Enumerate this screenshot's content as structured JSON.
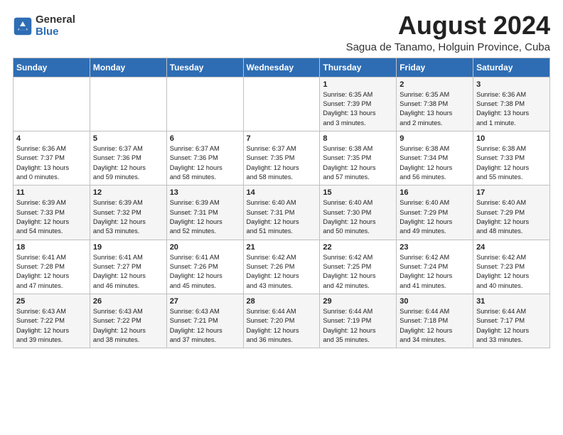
{
  "logo": {
    "general": "General",
    "blue": "Blue"
  },
  "title": "August 2024",
  "subtitle": "Sagua de Tanamo, Holguin Province, Cuba",
  "headers": [
    "Sunday",
    "Monday",
    "Tuesday",
    "Wednesday",
    "Thursday",
    "Friday",
    "Saturday"
  ],
  "weeks": [
    [
      {
        "day": "",
        "info": ""
      },
      {
        "day": "",
        "info": ""
      },
      {
        "day": "",
        "info": ""
      },
      {
        "day": "",
        "info": ""
      },
      {
        "day": "1",
        "info": "Sunrise: 6:35 AM\nSunset: 7:39 PM\nDaylight: 13 hours\nand 3 minutes."
      },
      {
        "day": "2",
        "info": "Sunrise: 6:35 AM\nSunset: 7:38 PM\nDaylight: 13 hours\nand 2 minutes."
      },
      {
        "day": "3",
        "info": "Sunrise: 6:36 AM\nSunset: 7:38 PM\nDaylight: 13 hours\nand 1 minute."
      }
    ],
    [
      {
        "day": "4",
        "info": "Sunrise: 6:36 AM\nSunset: 7:37 PM\nDaylight: 13 hours\nand 0 minutes."
      },
      {
        "day": "5",
        "info": "Sunrise: 6:37 AM\nSunset: 7:36 PM\nDaylight: 12 hours\nand 59 minutes."
      },
      {
        "day": "6",
        "info": "Sunrise: 6:37 AM\nSunset: 7:36 PM\nDaylight: 12 hours\nand 58 minutes."
      },
      {
        "day": "7",
        "info": "Sunrise: 6:37 AM\nSunset: 7:35 PM\nDaylight: 12 hours\nand 58 minutes."
      },
      {
        "day": "8",
        "info": "Sunrise: 6:38 AM\nSunset: 7:35 PM\nDaylight: 12 hours\nand 57 minutes."
      },
      {
        "day": "9",
        "info": "Sunrise: 6:38 AM\nSunset: 7:34 PM\nDaylight: 12 hours\nand 56 minutes."
      },
      {
        "day": "10",
        "info": "Sunrise: 6:38 AM\nSunset: 7:33 PM\nDaylight: 12 hours\nand 55 minutes."
      }
    ],
    [
      {
        "day": "11",
        "info": "Sunrise: 6:39 AM\nSunset: 7:33 PM\nDaylight: 12 hours\nand 54 minutes."
      },
      {
        "day": "12",
        "info": "Sunrise: 6:39 AM\nSunset: 7:32 PM\nDaylight: 12 hours\nand 53 minutes."
      },
      {
        "day": "13",
        "info": "Sunrise: 6:39 AM\nSunset: 7:31 PM\nDaylight: 12 hours\nand 52 minutes."
      },
      {
        "day": "14",
        "info": "Sunrise: 6:40 AM\nSunset: 7:31 PM\nDaylight: 12 hours\nand 51 minutes."
      },
      {
        "day": "15",
        "info": "Sunrise: 6:40 AM\nSunset: 7:30 PM\nDaylight: 12 hours\nand 50 minutes."
      },
      {
        "day": "16",
        "info": "Sunrise: 6:40 AM\nSunset: 7:29 PM\nDaylight: 12 hours\nand 49 minutes."
      },
      {
        "day": "17",
        "info": "Sunrise: 6:40 AM\nSunset: 7:29 PM\nDaylight: 12 hours\nand 48 minutes."
      }
    ],
    [
      {
        "day": "18",
        "info": "Sunrise: 6:41 AM\nSunset: 7:28 PM\nDaylight: 12 hours\nand 47 minutes."
      },
      {
        "day": "19",
        "info": "Sunrise: 6:41 AM\nSunset: 7:27 PM\nDaylight: 12 hours\nand 46 minutes."
      },
      {
        "day": "20",
        "info": "Sunrise: 6:41 AM\nSunset: 7:26 PM\nDaylight: 12 hours\nand 45 minutes."
      },
      {
        "day": "21",
        "info": "Sunrise: 6:42 AM\nSunset: 7:26 PM\nDaylight: 12 hours\nand 43 minutes."
      },
      {
        "day": "22",
        "info": "Sunrise: 6:42 AM\nSunset: 7:25 PM\nDaylight: 12 hours\nand 42 minutes."
      },
      {
        "day": "23",
        "info": "Sunrise: 6:42 AM\nSunset: 7:24 PM\nDaylight: 12 hours\nand 41 minutes."
      },
      {
        "day": "24",
        "info": "Sunrise: 6:42 AM\nSunset: 7:23 PM\nDaylight: 12 hours\nand 40 minutes."
      }
    ],
    [
      {
        "day": "25",
        "info": "Sunrise: 6:43 AM\nSunset: 7:22 PM\nDaylight: 12 hours\nand 39 minutes."
      },
      {
        "day": "26",
        "info": "Sunrise: 6:43 AM\nSunset: 7:22 PM\nDaylight: 12 hours\nand 38 minutes."
      },
      {
        "day": "27",
        "info": "Sunrise: 6:43 AM\nSunset: 7:21 PM\nDaylight: 12 hours\nand 37 minutes."
      },
      {
        "day": "28",
        "info": "Sunrise: 6:44 AM\nSunset: 7:20 PM\nDaylight: 12 hours\nand 36 minutes."
      },
      {
        "day": "29",
        "info": "Sunrise: 6:44 AM\nSunset: 7:19 PM\nDaylight: 12 hours\nand 35 minutes."
      },
      {
        "day": "30",
        "info": "Sunrise: 6:44 AM\nSunset: 7:18 PM\nDaylight: 12 hours\nand 34 minutes."
      },
      {
        "day": "31",
        "info": "Sunrise: 6:44 AM\nSunset: 7:17 PM\nDaylight: 12 hours\nand 33 minutes."
      }
    ]
  ]
}
